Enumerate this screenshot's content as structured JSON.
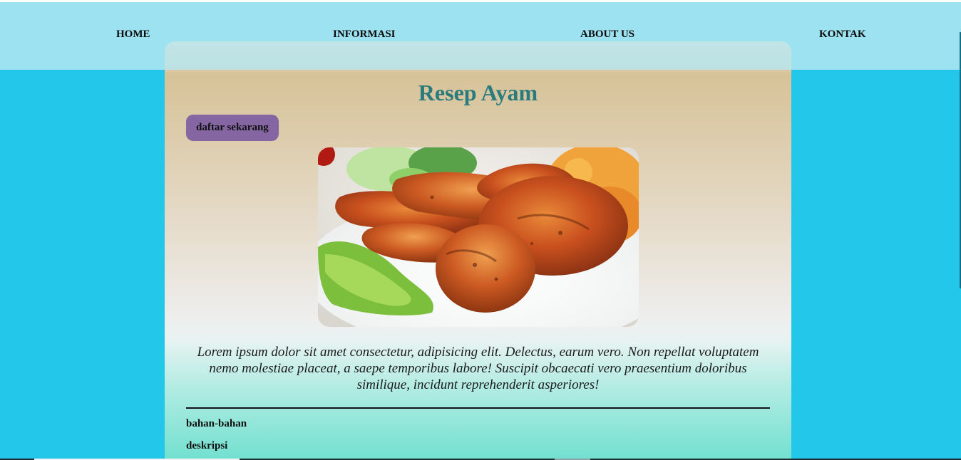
{
  "nav": {
    "items": [
      {
        "label": "HOME"
      },
      {
        "label": "INFORMASI"
      },
      {
        "label": "ABOUT US"
      },
      {
        "label": "KONTAK"
      }
    ]
  },
  "content": {
    "title": "Resep Ayam",
    "register_button": "daftar sekarang",
    "image": {
      "subject": "roasted chicken drumsticks on a plate with lettuce"
    },
    "description": "Lorem ipsum dolor sit amet consectetur, adipisicing elit. Delectus, earum vero. Non repellat voluptatem nemo molestiae placeat, a saepe temporibus labore! Suscipit obcaecati vero praesentium doloribus similique, incidunt reprehenderit asperiores!",
    "links": [
      {
        "label": "bahan-bahan"
      },
      {
        "label": "deskripsi"
      }
    ]
  },
  "colors": {
    "page_background": "#22c7ea",
    "navbar_background": "#b7e8f2",
    "title": "#2a7b7b",
    "button_background": "#8566a2"
  }
}
